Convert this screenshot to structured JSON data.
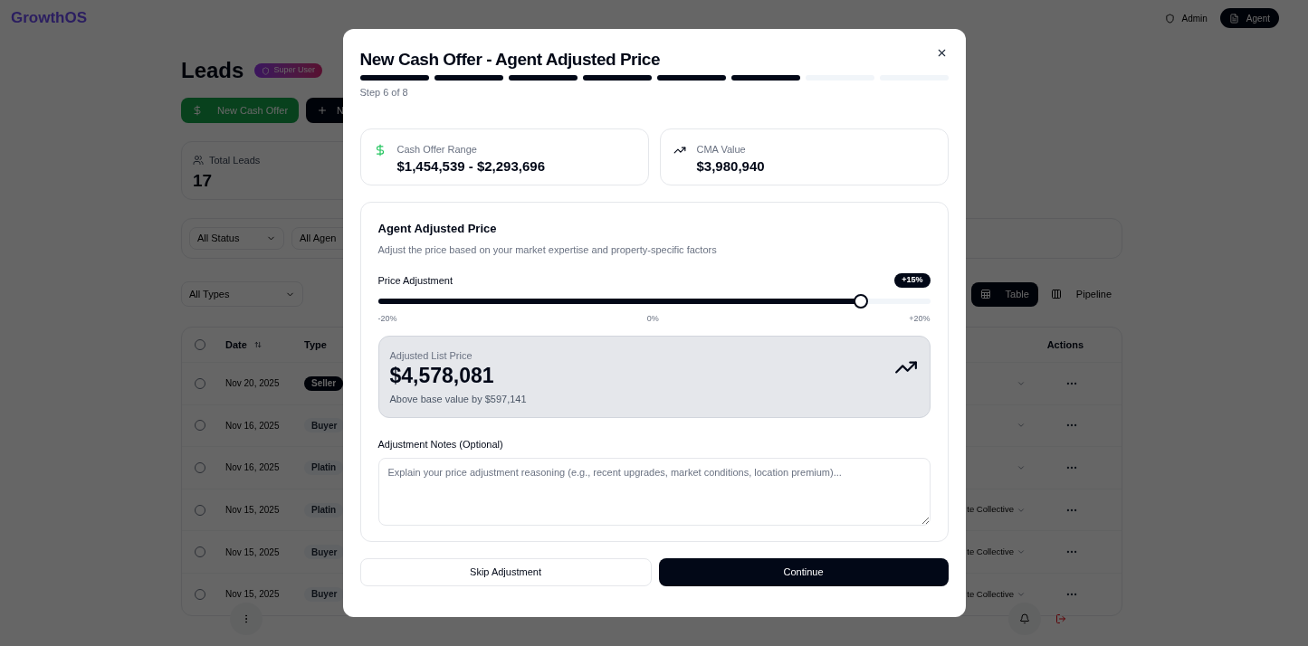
{
  "app": {
    "logo": "GrowthOS",
    "roles": [
      {
        "label": "Admin",
        "selected": false
      },
      {
        "label": "Agent",
        "selected": true
      }
    ]
  },
  "page": {
    "title": "Leads",
    "badge": "Super User",
    "actions": [
      {
        "label": "New Cash Offer",
        "kind": "cash"
      },
      {
        "label": "N",
        "kind": "new"
      }
    ],
    "stats": [
      {
        "label": "Total Leads",
        "value": "17"
      }
    ],
    "filters": [
      "All Status",
      "All Agen"
    ],
    "type_filter": "All Types",
    "views": [
      {
        "label": "Table",
        "selected": true
      },
      {
        "label": "Pipeline",
        "selected": false
      }
    ]
  },
  "table": {
    "columns": [
      "Date",
      "Type",
      "Actions"
    ],
    "all_checked": false,
    "rows": [
      {
        "checked": false,
        "date": "Nov 20, 2025",
        "type": "Seller",
        "color": "#020817"
      },
      {
        "checked": false,
        "date": "Nov 16, 2025",
        "type": "Buyer",
        "color": "#f1f5f9"
      },
      {
        "checked": false,
        "date": "Nov 16, 2025",
        "type": "Platin",
        "color": "#f1f5f9"
      },
      {
        "checked": false,
        "date": "Nov 15, 2025",
        "type": "Platin",
        "color": "#f1f5f9",
        "column_3": "te Collective"
      },
      {
        "checked": false,
        "date": "Nov 15, 2025",
        "type": "Buyer",
        "color": "#f1f5f9",
        "column_3": "te Collective"
      },
      {
        "checked": false,
        "date": "Nov 15, 2025",
        "type": "Buyer",
        "color": "#f1f5f9",
        "column_3": "te Collective"
      }
    ]
  },
  "dialog": {
    "title": "New Cash Offer - Agent Adjusted Price",
    "steps": [
      {
        "done": true
      },
      {
        "done": true
      },
      {
        "done": true
      },
      {
        "done": true
      },
      {
        "done": true
      },
      {
        "done": true
      },
      {
        "done": false
      },
      {
        "done": false
      }
    ],
    "step_text": "Step 6 of 8",
    "summary": [
      {
        "kind": "cash",
        "label": "Cash Offer Range",
        "value": "$1,454,539 - $2,293,696"
      },
      {
        "kind": "cma",
        "label": "CMA Value",
        "value": "$3,980,940"
      }
    ],
    "section": {
      "title": "Agent Adjusted Price",
      "description": "Adjust the price based on your market expertise and property-specific factors",
      "slider": {
        "label": "Price Adjustment",
        "badge": "+15%",
        "level": 0.875,
        "ticks": [
          "-20%",
          "0%",
          "+20%"
        ]
      },
      "result": {
        "label": "Adjusted List Price",
        "value": "$4,578,081",
        "note": "Above base value by $597,141"
      },
      "notes": {
        "label": "Adjustment Notes (Optional)",
        "placeholder": "Explain your price adjustment reasoning (e.g., recent upgrades, market conditions, location premium)..."
      }
    },
    "buttons": [
      {
        "label": "Skip Adjustment",
        "kind": "secondary"
      },
      {
        "label": "Continue",
        "kind": "primary"
      }
    ]
  }
}
